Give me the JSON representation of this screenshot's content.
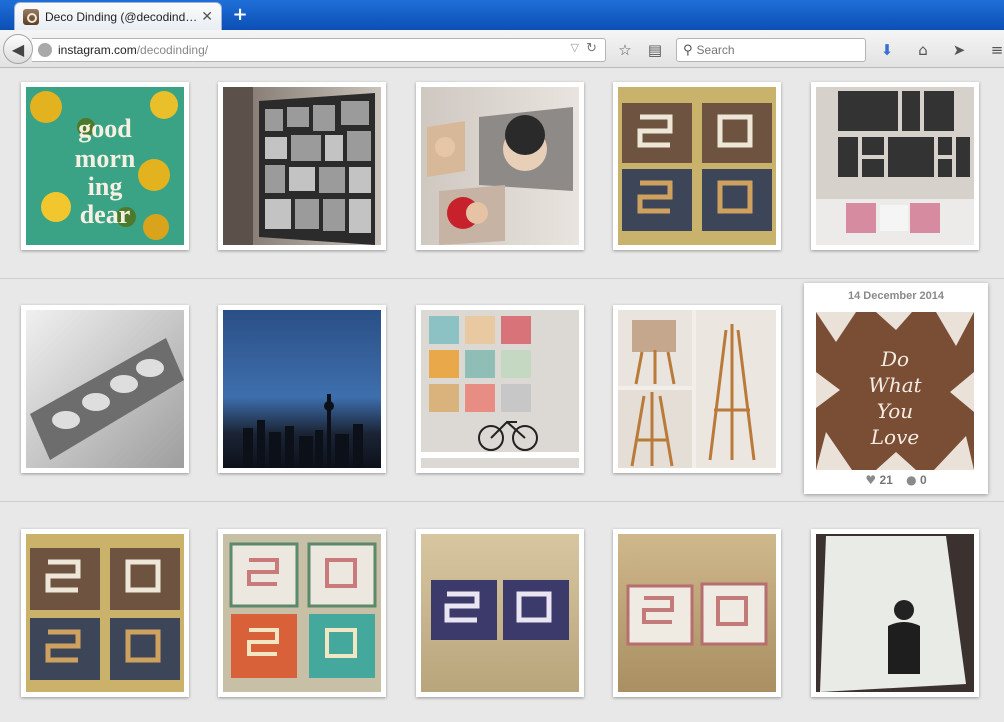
{
  "browser": {
    "tab_title": "Deco Dinding (@decodinding) ...",
    "tab_close": "✕",
    "new_tab": "+",
    "url_domain": "instagram.com",
    "url_path": "/decodinding/",
    "search_placeholder": "Search"
  },
  "feature": {
    "date": "14 December 2014",
    "likes": "21",
    "comments": "0"
  },
  "photos": [
    {
      "row": 0,
      "col": 0,
      "subject": "good-morning-dear-typography"
    },
    {
      "row": 0,
      "col": 1,
      "subject": "photo-collage-canvas"
    },
    {
      "row": 0,
      "col": 2,
      "subject": "baby-canvas-wall"
    },
    {
      "row": 0,
      "col": 3,
      "subject": "calligraphy-wood-panels"
    },
    {
      "row": 0,
      "col": 4,
      "subject": "gallery-wall-sofa"
    },
    {
      "row": 1,
      "col": 0,
      "subject": "babies-canvas-print"
    },
    {
      "row": 1,
      "col": 1,
      "subject": "city-skyline-night"
    },
    {
      "row": 1,
      "col": 2,
      "subject": "shelf-canvas-grid"
    },
    {
      "row": 1,
      "col": 3,
      "subject": "easel-collage"
    },
    {
      "row": 2,
      "col": 0,
      "subject": "calligraphy-wood-panels-2"
    },
    {
      "row": 2,
      "col": 1,
      "subject": "floral-calligraphy-panels"
    },
    {
      "row": 2,
      "col": 2,
      "subject": "blue-pattern-calligraphy"
    },
    {
      "row": 2,
      "col": 3,
      "subject": "floral-frames-calligraphy"
    },
    {
      "row": 2,
      "col": 4,
      "subject": "portrait-canvas"
    }
  ]
}
